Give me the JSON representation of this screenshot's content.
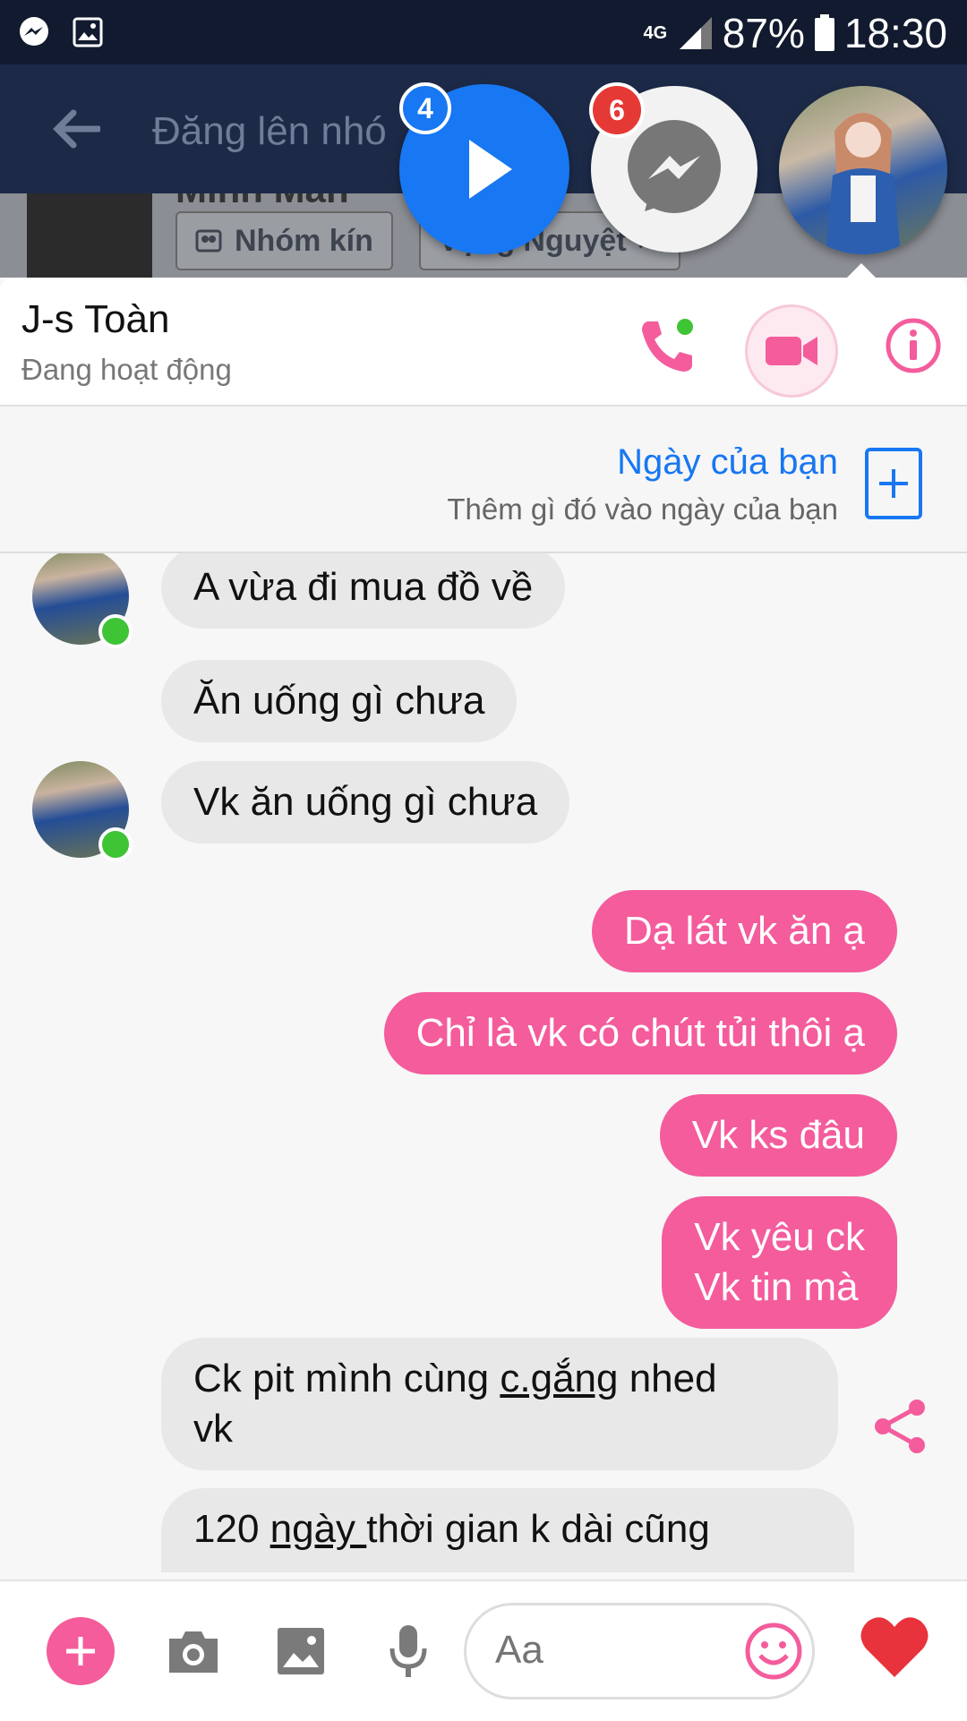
{
  "status_bar": {
    "network": "4G",
    "battery": "87%",
    "time": "18:30",
    "icons": [
      "messenger-icon",
      "gallery-icon",
      "signal-icon",
      "battery-icon"
    ]
  },
  "background_app": {
    "title": "Đăng lên nhó",
    "group_name": "Minh Mãn",
    "chips": [
      "Nhóm kín",
      "Vọng Nguyệt ✕"
    ]
  },
  "chat_heads": [
    {
      "name": "play-head",
      "badge": "4"
    },
    {
      "name": "messenger-head",
      "badge": "6"
    },
    {
      "name": "contact-head",
      "badge": ""
    }
  ],
  "chat": {
    "contact_name": "J-s Toàn",
    "contact_status": "Đang hoạt động",
    "my_day": {
      "title": "Ngày của bạn",
      "subtitle": "Thêm gì đó vào ngày của bạn"
    },
    "messages": [
      {
        "side": "in",
        "text": "A vừa đi mua đồ về"
      },
      {
        "side": "in",
        "text": "Ăn uống gì chưa"
      },
      {
        "side": "in",
        "text": "Vk ăn uống gì chưa"
      },
      {
        "side": "out",
        "text": "Dạ lát vk ăn ạ"
      },
      {
        "side": "out",
        "text": "Chỉ là vk có chút tủi thôi ạ"
      },
      {
        "side": "out",
        "text": "Vk ks đâu"
      },
      {
        "side": "out",
        "line1": "Vk yêu ck",
        "line2": "Vk tin mà"
      },
      {
        "side": "in",
        "pre": "Ck pit mình cùng ",
        "under": "c.gắng",
        "post": " nhed",
        "line2": "vk"
      },
      {
        "side": "in",
        "pre": "120 ",
        "under": "ngày ",
        "post": "thời gian k dài cũng"
      }
    ]
  },
  "composer": {
    "placeholder": "Aa"
  },
  "colors": {
    "accent_pink": "#f45c9c",
    "messenger_blue": "#1877f2",
    "online_green": "#3ec435",
    "status_bar": "#111a2e"
  }
}
